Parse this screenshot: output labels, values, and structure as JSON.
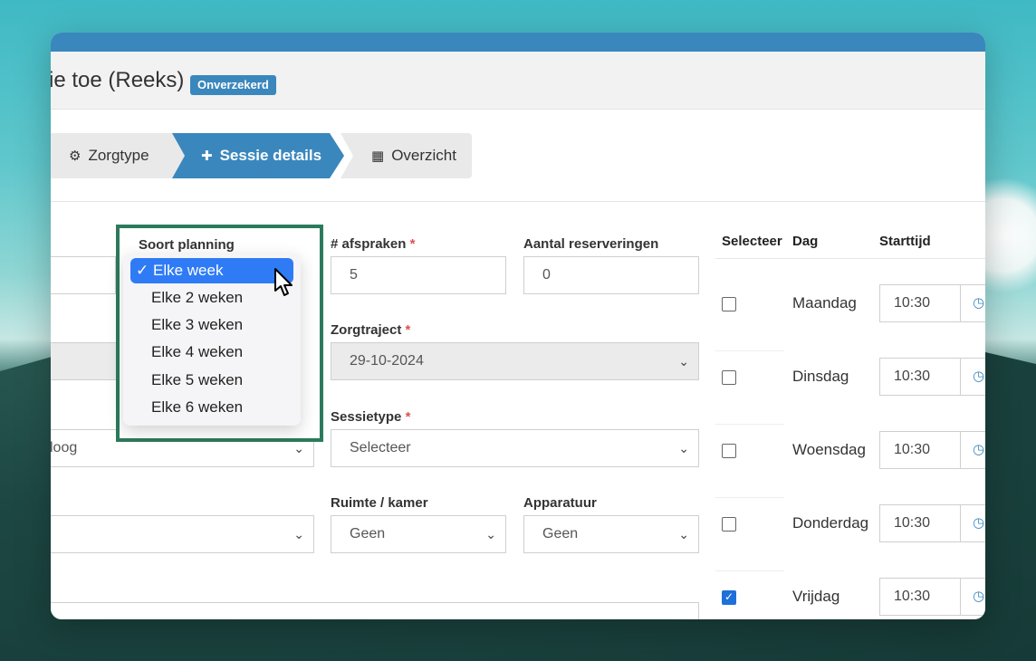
{
  "header": {
    "title": "ie toe (Reeks)",
    "badge": "Onverzekerd"
  },
  "steps": [
    {
      "label": "Zorgtype",
      "icon": "gear-icon"
    },
    {
      "label": "Sessie details",
      "icon": "puzzle-icon"
    },
    {
      "label": "Overzicht",
      "icon": "table-icon"
    }
  ],
  "form": {
    "soort_planning": {
      "label": "Soort planning",
      "options": [
        "Elke week",
        "Elke 2 weken",
        "Elke 3 weken",
        "Elke 4 weken",
        "Elke 5 weken",
        "Elke 6 weken"
      ],
      "selected": "Elke week",
      "check": "✓"
    },
    "afspraken": {
      "label": "# afspraken",
      "required": "*",
      "value": "5"
    },
    "reserveringen": {
      "label": "Aantal reserveringen",
      "value": "0"
    },
    "zorgtraject": {
      "label": "Zorgtraject",
      "required": "*",
      "value": "29-10-2024"
    },
    "sessietype": {
      "label": "Sessietype",
      "required": "*",
      "value": "Selecteer"
    },
    "left_select": {
      "value": "loog"
    },
    "ruimte": {
      "label": "Ruimte / kamer",
      "value": "Geen"
    },
    "apparatuur": {
      "label": "Apparatuur",
      "value": "Geen"
    }
  },
  "schedule": {
    "headers": {
      "select": "Selecteer",
      "day": "Dag",
      "start": "Starttijd"
    },
    "rows": [
      {
        "day": "Maandag",
        "time": "10:30",
        "checked": false
      },
      {
        "day": "Dinsdag",
        "time": "10:30",
        "checked": false
      },
      {
        "day": "Woensdag",
        "time": "10:30",
        "checked": false
      },
      {
        "day": "Donderdag",
        "time": "10:30",
        "checked": false
      },
      {
        "day": "Vrijdag",
        "time": "10:30",
        "checked": true
      }
    ]
  },
  "colors": {
    "accent": "#3a87bd",
    "highlight_frame": "#2c7a5c",
    "menu_active": "#2f7bf6"
  }
}
